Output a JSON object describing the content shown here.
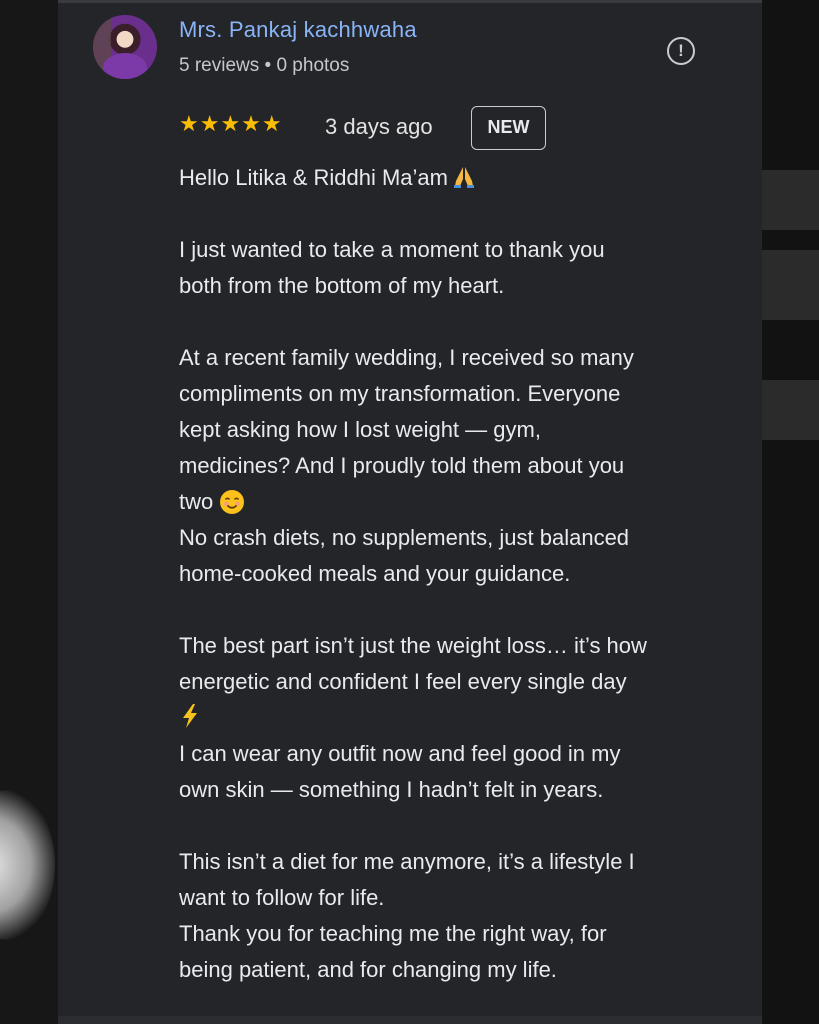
{
  "reviewer": {
    "name": "Mrs. Pankaj kachhwaha",
    "meta": "5 reviews • 0 photos"
  },
  "review": {
    "stars": "★★★★★",
    "rating": 5,
    "time": "3 days ago",
    "badge": "NEW",
    "lines": {
      "l1": "Hello Litika & Riddhi Ma’am",
      "l2": "I just wanted to take a moment to thank you",
      "l3": "both from the bottom of my heart.",
      "l4": "At a recent family wedding, I received so many",
      "l5": "compliments on my transformation. Everyone",
      "l6": "kept asking how I lost weight — gym,",
      "l7": "medicines? And I proudly told them about you",
      "l8": "two",
      "l9": "No crash diets, no supplements, just balanced",
      "l10": "home-cooked meals and your guidance.",
      "l11": "The best part isn’t just the weight loss… it’s how",
      "l12": "energetic and confident I feel every single day",
      "l13": "I can wear any outfit now and feel good in my",
      "l14": "own skin — something I hadn’t felt in years.",
      "l15": "This isn’t a diet for me anymore, it’s a lifestyle I",
      "l16": "want to follow for life.",
      "l17": "Thank you for teaching me the right way, for",
      "l18": "being patient, and for changing my life."
    }
  },
  "icons": {
    "report": "report-icon",
    "pray": "folded-hands-emoji",
    "smile": "smiling-face-emoji",
    "bolt": "lightning-emoji"
  },
  "colors": {
    "name": "#8ab4f8",
    "stars": "#fbbc04",
    "card_bg": "#242528"
  }
}
